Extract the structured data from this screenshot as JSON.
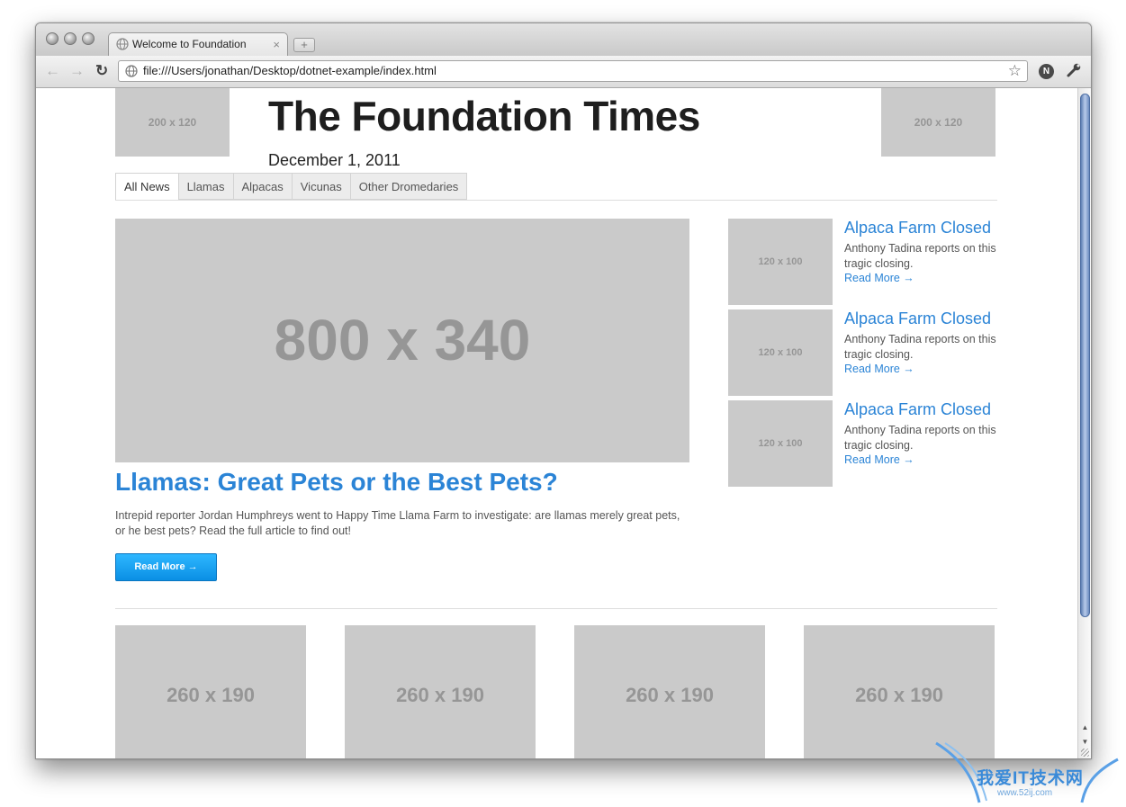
{
  "browser": {
    "tab_title": "Welcome to Foundation",
    "tab_close": "×",
    "new_tab": "+",
    "back": "←",
    "forward": "→",
    "reload": "↻",
    "url": "file:///Users/jonathan/Desktop/dotnet-example/index.html",
    "bookmark_star": "☆",
    "extension_label": "N"
  },
  "header": {
    "left_logo_placeholder": "200 x 120",
    "right_logo_placeholder": "200 x 120",
    "title": "The Foundation Times",
    "date": "December 1, 2011"
  },
  "nav_tabs": [
    "All News",
    "Llamas",
    "Alpacas",
    "Vicunas",
    "Other Dromedaries"
  ],
  "feature": {
    "image_placeholder": "800 x 340",
    "title": "Llamas: Great Pets or the Best Pets?",
    "body": "Intrepid reporter Jordan Humphreys went to Happy Time Llama Farm to investigate: are llamas merely great pets, or he best pets? Read the full article to find out!",
    "button": "Read More →"
  },
  "side_stories": [
    {
      "thumb": "120 x 100",
      "title": "Alpaca Farm Closed",
      "body": "Anthony Tadina reports on this tragic closing.",
      "link": "Read More →"
    },
    {
      "thumb": "120 x 100",
      "title": "Alpaca Farm Closed",
      "body": "Anthony Tadina reports on this tragic closing.",
      "link": "Read More →"
    },
    {
      "thumb": "120 x 100",
      "title": "Alpaca Farm Closed",
      "body": "Anthony Tadina reports on this tragic closing.",
      "link": "Read More →"
    }
  ],
  "bottom_placeholders": [
    "260 x 190",
    "260 x 190",
    "260 x 190",
    "260 x 190"
  ],
  "watermark": {
    "text": "我爱IT技术网",
    "sub": "www.52ij.com"
  },
  "colors": {
    "link": "#2b84d6",
    "button": "#1aa3f5",
    "placeholder": "#cacaca"
  }
}
